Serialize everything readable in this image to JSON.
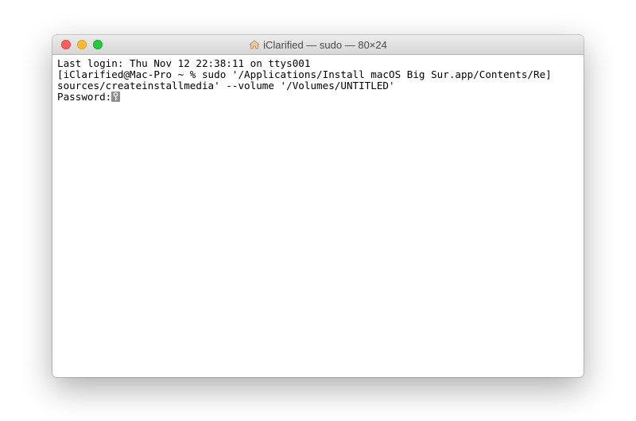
{
  "window": {
    "title": "iClarified — sudo — 80×24",
    "title_icon": "home-icon"
  },
  "terminal": {
    "lines": [
      "Last login: Thu Nov 12 22:38:11 on ttys001",
      "[iClarified@Mac-Pro ~ % sudo '/Applications/Install macOS Big Sur.app/Contents/Re]",
      "sources/createinstallmedia' --volume '/Volumes/UNTITLED'"
    ],
    "prompt": "Password:",
    "cursor_icon": "key-icon"
  }
}
